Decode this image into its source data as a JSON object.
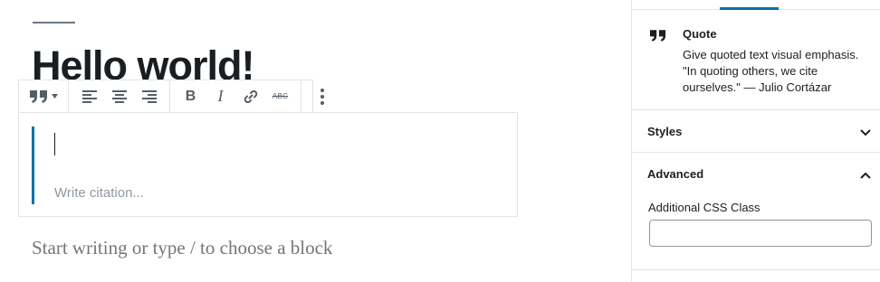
{
  "editor": {
    "post_title": "Hello world!",
    "citation_placeholder": "Write citation...",
    "appender_placeholder": "Start writing or type / to choose a block"
  },
  "toolbar": {
    "groups": [
      {
        "items": [
          "quote-icon",
          "chevron-down-icon"
        ]
      },
      {
        "items": [
          "align-left-icon",
          "align-center-icon",
          "align-right-icon"
        ]
      },
      {
        "items": [
          "bold",
          "italic",
          "link-icon",
          "strikethrough"
        ]
      },
      {
        "items": [
          "more-options-icon"
        ]
      }
    ],
    "bold_label": "B",
    "italic_label": "I",
    "strikethrough_label": "ABC"
  },
  "sidebar": {
    "block": {
      "icon": "quote-icon",
      "title": "Quote",
      "description": "Give quoted text visual emphasis. \"In quoting others, we cite ourselves.\" — Julio Cortázar"
    },
    "panels": [
      {
        "title": "Styles",
        "expanded": false
      },
      {
        "title": "Advanced",
        "expanded": true
      }
    ],
    "advanced": {
      "css_class_label": "Additional CSS Class",
      "css_class_value": ""
    }
  },
  "colors": {
    "accent": "#0073aa",
    "border": "#e2e4e7",
    "text": "#1e1e1e",
    "placeholder": "#757575"
  }
}
